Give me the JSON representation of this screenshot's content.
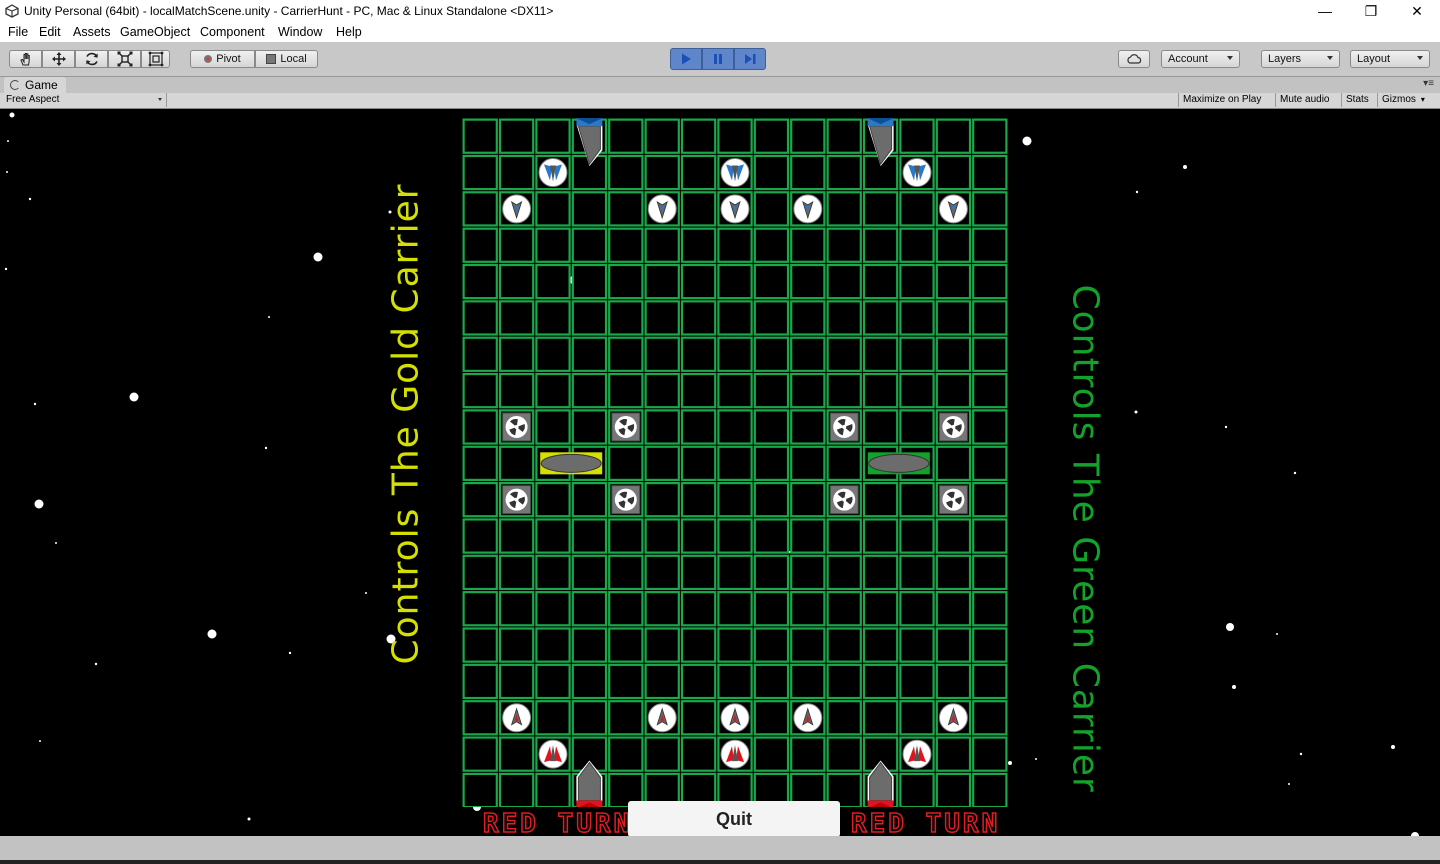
{
  "window": {
    "title": "Unity Personal (64bit) - localMatchScene.unity - CarrierHunt - PC, Mac & Linux Standalone <DX11>",
    "controls": {
      "minimize": "—",
      "maximize": "❐",
      "close": "✕"
    }
  },
  "menu": {
    "items": [
      "File",
      "Edit",
      "Assets",
      "GameObject",
      "Component",
      "Window",
      "Help"
    ]
  },
  "toolbar": {
    "tools": [
      "hand-icon",
      "move-icon",
      "rotate-icon",
      "scale-icon",
      "rect-icon"
    ],
    "pivot_label": "Pivot",
    "local_label": "Local",
    "play_state": "playing",
    "account_label": "Account",
    "layers_label": "Layers",
    "layout_label": "Layout"
  },
  "game_panel": {
    "tab_label": "Game",
    "aspect_label": "Free Aspect",
    "options": [
      "Maximize on Play",
      "Mute audio",
      "Stats",
      "Gizmos"
    ]
  },
  "game": {
    "left_label": "Controls The Gold Carrier",
    "right_label": "Controls The Green Carrier",
    "turn_left": "RED TURN",
    "turn_right": "RED TURN",
    "quit_label": "Quit",
    "grid": {
      "cols": 15,
      "rows": 19
    },
    "pieces": [
      {
        "kind": "carrier-blue",
        "col": 3,
        "row": 0
      },
      {
        "kind": "carrier-blue",
        "col": 11,
        "row": 0
      },
      {
        "kind": "fighter-blue",
        "col": 2,
        "row": 1
      },
      {
        "kind": "fighter-blue",
        "col": 7,
        "row": 1
      },
      {
        "kind": "fighter-blue",
        "col": 12,
        "row": 1
      },
      {
        "kind": "scout-blue",
        "col": 1,
        "row": 2
      },
      {
        "kind": "scout-blue",
        "col": 5,
        "row": 2
      },
      {
        "kind": "scout-blue",
        "col": 7,
        "row": 2
      },
      {
        "kind": "scout-blue",
        "col": 9,
        "row": 2
      },
      {
        "kind": "scout-blue",
        "col": 13,
        "row": 2
      },
      {
        "kind": "turret",
        "col": 1,
        "row": 8
      },
      {
        "kind": "turret",
        "col": 4,
        "row": 8
      },
      {
        "kind": "turret",
        "col": 10,
        "row": 8
      },
      {
        "kind": "turret",
        "col": 13,
        "row": 8
      },
      {
        "kind": "turret",
        "col": 1,
        "row": 10
      },
      {
        "kind": "turret",
        "col": 4,
        "row": 10
      },
      {
        "kind": "turret",
        "col": 10,
        "row": 10
      },
      {
        "kind": "turret",
        "col": 13,
        "row": 10
      },
      {
        "kind": "carrier-gold",
        "col": 2,
        "row": 9,
        "span": 2
      },
      {
        "kind": "carrier-green",
        "col": 11,
        "row": 9,
        "span": 2
      },
      {
        "kind": "scout-red",
        "col": 1,
        "row": 16
      },
      {
        "kind": "scout-red",
        "col": 5,
        "row": 16
      },
      {
        "kind": "scout-red",
        "col": 7,
        "row": 16
      },
      {
        "kind": "scout-red",
        "col": 9,
        "row": 16
      },
      {
        "kind": "scout-red",
        "col": 13,
        "row": 16
      },
      {
        "kind": "fighter-red",
        "col": 2,
        "row": 17
      },
      {
        "kind": "fighter-red",
        "col": 7,
        "row": 17
      },
      {
        "kind": "fighter-red",
        "col": 12,
        "row": 17
      },
      {
        "kind": "carrier-red",
        "col": 3,
        "row": 18
      },
      {
        "kind": "carrier-red",
        "col": 11,
        "row": 18
      }
    ]
  },
  "colors": {
    "grid_line": "#1aa84a",
    "accent_play": "#5f86c9",
    "gold_label": "#d4e000",
    "green_label": "#13a32a",
    "turn_text": "#e31b23",
    "blue_team": "#2a78c8",
    "red_team": "#e0141e"
  }
}
